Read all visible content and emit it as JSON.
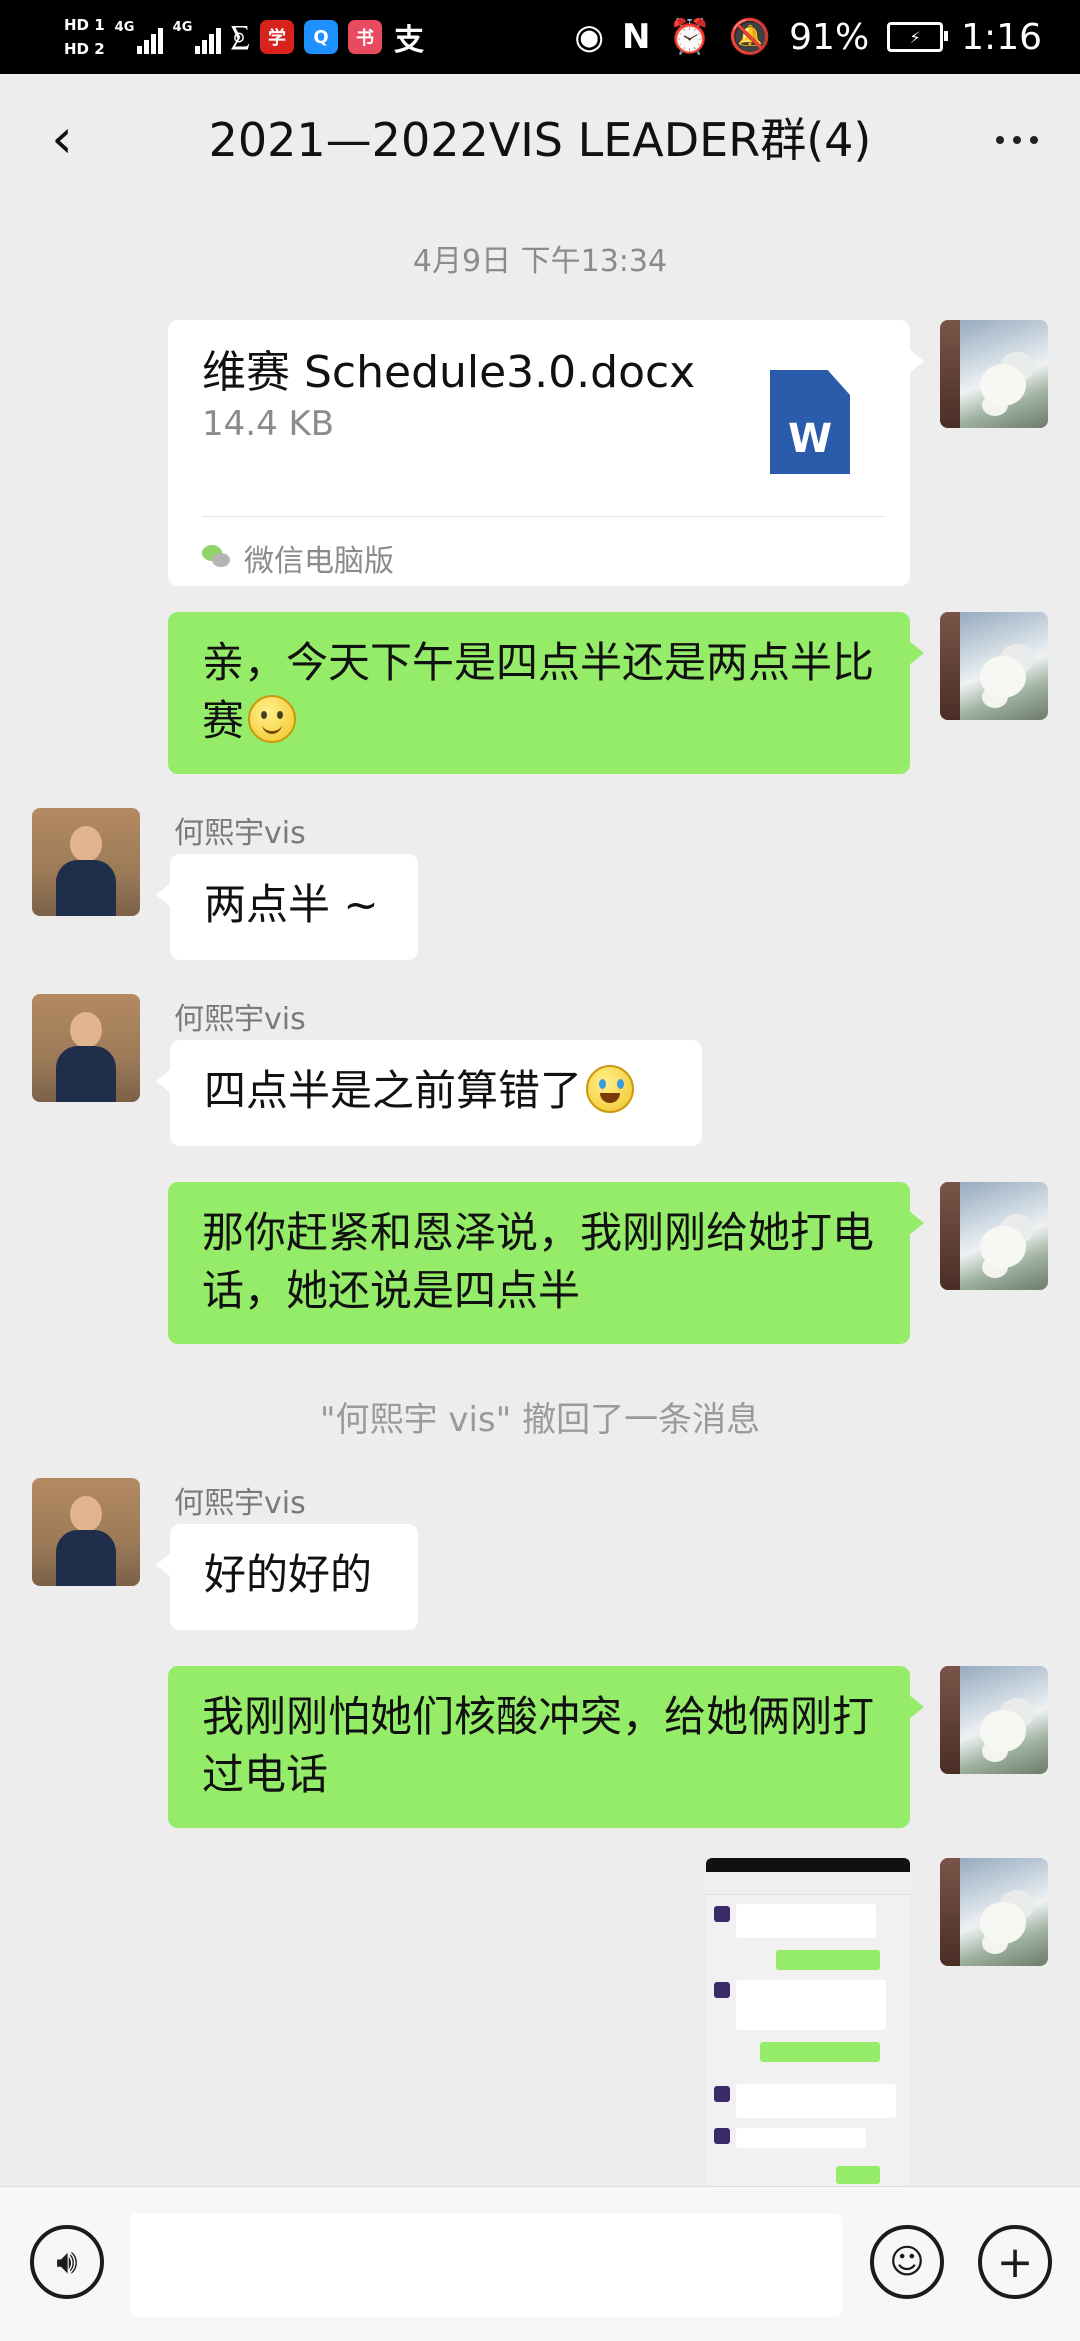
{
  "status_bar": {
    "hd1": "HD 1",
    "hd2": "HD 2",
    "net1": "4G",
    "net2": "4G",
    "battery_percent": "91%",
    "time": "1:16",
    "app_icons": [
      "学",
      "Q",
      "书",
      "支"
    ]
  },
  "header": {
    "title": "2021—2022VIS LEADER群(4)",
    "back_icon": "chevron-left-icon",
    "more_icon": "more-dots-icon"
  },
  "chat": {
    "timestamp": "4月9日 下午13:34",
    "file_card": {
      "filename": "维赛 Schedule3.0.docx",
      "filesize": "14.4 KB",
      "icon_letter": "W",
      "source": "微信电脑版"
    },
    "messages": [
      {
        "sender": "me",
        "text": "亲，今天下午是四点半还是两点半比赛"
      },
      {
        "sender": "何熙宇vis",
        "text": "两点半 ~"
      },
      {
        "sender": "何熙宇vis",
        "text": "四点半是之前算错了"
      },
      {
        "sender": "me",
        "text": "那你赶紧和恩泽说，我刚刚给她打电话，她还说是四点半"
      },
      {
        "sender": "system",
        "text": "\"何熙宇 vis\" 撤回了一条消息"
      },
      {
        "sender": "何熙宇vis",
        "text": "好的好的"
      },
      {
        "sender": "me",
        "text": "我刚刚怕她们核酸冲突，给她俩刚打过电话"
      }
    ]
  },
  "input_bar": {
    "voice_icon": "voice-icon",
    "emoji_icon": "emoji-icon",
    "plus_icon": "plus-icon",
    "input_value": ""
  },
  "colors": {
    "my_bubble": "#95ec69",
    "other_bubble": "#ffffff",
    "background": "#ededed"
  }
}
